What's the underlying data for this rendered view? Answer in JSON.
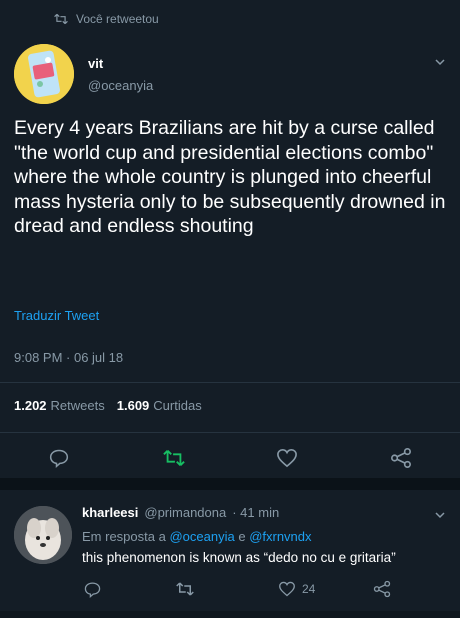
{
  "retweet_banner": {
    "icon": "retweet-icon",
    "text": "Você retweetou"
  },
  "tweet": {
    "author_name": "vit",
    "author_handle": "@oceanyia",
    "text": "Every 4 years Brazilians are hit by a curse called \"the world cup and presidential elections combo\" where the whole country is plunged into cheerful mass hysteria only to be subsequently drowned in dread and endless shouting",
    "translate_label": "Traduzir Tweet",
    "timestamp": "9:08 PM · 06 jul 18",
    "retweets_count": "1.202",
    "retweets_label": "Retweets",
    "likes_count": "1.609",
    "likes_label": "Curtidas"
  },
  "reply": {
    "author_name": "kharleesi",
    "author_handle": "@primandona",
    "time": "· 41 min",
    "reply_prefix": "Em resposta a",
    "reply_user1": "@oceanyia",
    "reply_and": "e",
    "reply_user2": "@fxrnvndx",
    "text": "this phenomenon is known as “dedo no cu e gritaria”",
    "likes_count": "24"
  },
  "colors": {
    "background": "#141d26",
    "muted": "#8899a6",
    "accent": "#1da1f2",
    "retweet_green": "#17bf63"
  }
}
